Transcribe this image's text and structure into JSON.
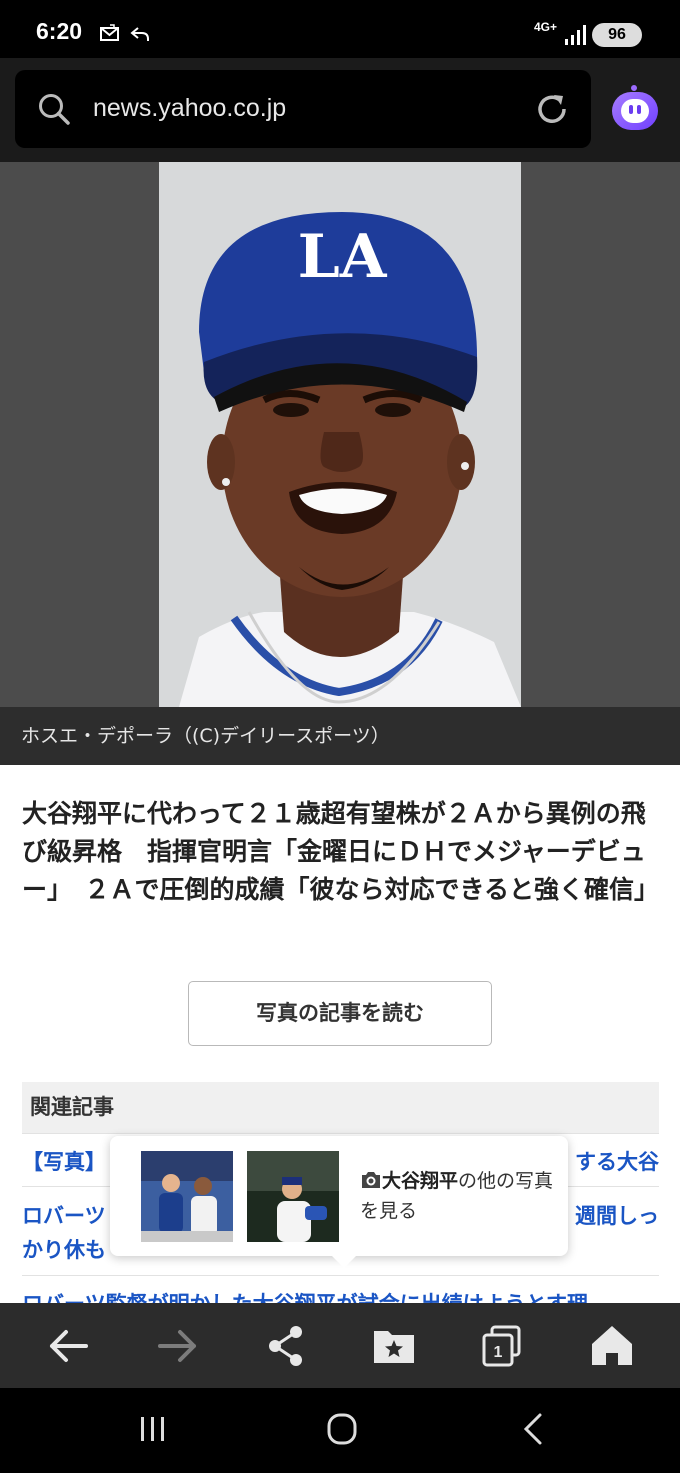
{
  "status_bar": {
    "time": "6:20",
    "network": "4G+",
    "battery": "96"
  },
  "browser": {
    "url": "news.yahoo.co.jp"
  },
  "photo": {
    "caption": "ホスエ・デポーラ（(C)デイリースポーツ）"
  },
  "article": {
    "headline": "大谷翔平に代わって２１歳超有望株が２Ａから異例の飛び級昇格　指揮官明言「金曜日にＤＨでメジャーデビュー」　２Ａで圧倒的成績「彼なら対応できると強く確信」",
    "read_button": "写真の記事を読む"
  },
  "related": {
    "header": "関連記事",
    "items": [
      {
        "left": "【写真】",
        "right": "する大谷"
      },
      {
        "left": "ロバーツ",
        "right": "週間しっ",
        "line2": "かり休も"
      },
      {
        "text": "ロバーツ監督が明かした大谷翔平が試合に出続けようとす理"
      }
    ]
  },
  "tooltip": {
    "bold": "大谷翔平",
    "rest": "の他の写真を見る"
  },
  "colors": {
    "link": "#1a55c4",
    "toolbar": "#2c2c2c"
  }
}
